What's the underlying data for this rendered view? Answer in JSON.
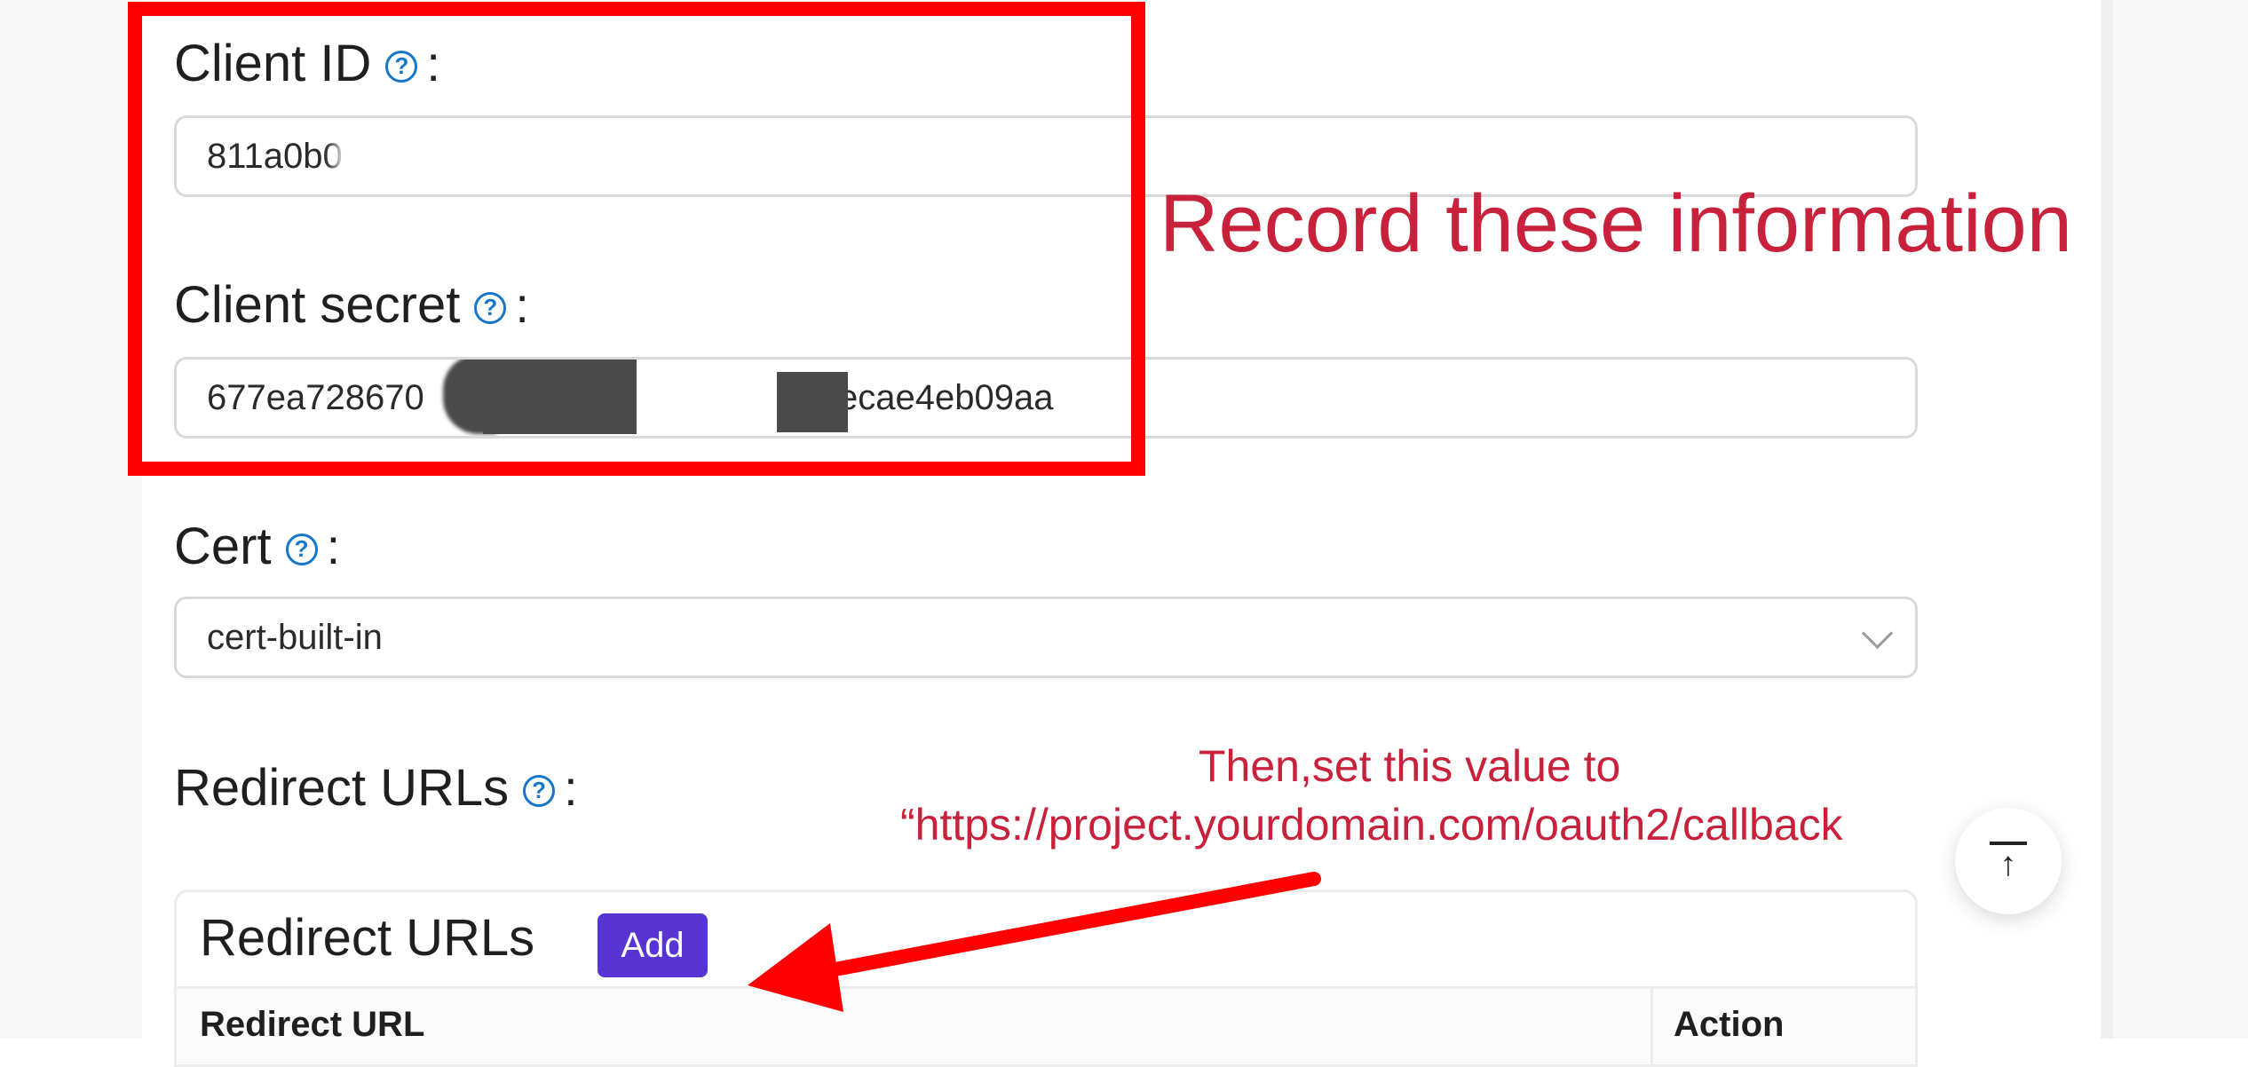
{
  "form": {
    "client_id": {
      "label": "Client ID",
      "colon": ":",
      "value": "811a0b0"
    },
    "client_secret": {
      "label": "Client secret",
      "colon": ":",
      "value_start": "677ea728670",
      "value_end": "ecae4eb09aa"
    },
    "cert": {
      "label": "Cert",
      "colon": ":",
      "selected": "cert-built-in"
    },
    "redirect_urls": {
      "label": "Redirect URLs",
      "colon": ":"
    }
  },
  "redirect_table": {
    "title": "Redirect URLs",
    "add_label": "Add",
    "columns": [
      "Redirect URL",
      "Action"
    ]
  },
  "annotations": {
    "record": "Record these information",
    "then_line1": "Then,set this value to",
    "then_line2": "“https://project.yourdomain.com/oauth2/callback",
    "color": "#c8213b",
    "box_color": "#ff0000"
  },
  "icons": {
    "help": "question-circle-icon",
    "help_glyph": "?",
    "select": "chevron-down-icon",
    "back_to_top": "vertical-align-top-icon",
    "back_to_top_glyph": "↑"
  }
}
